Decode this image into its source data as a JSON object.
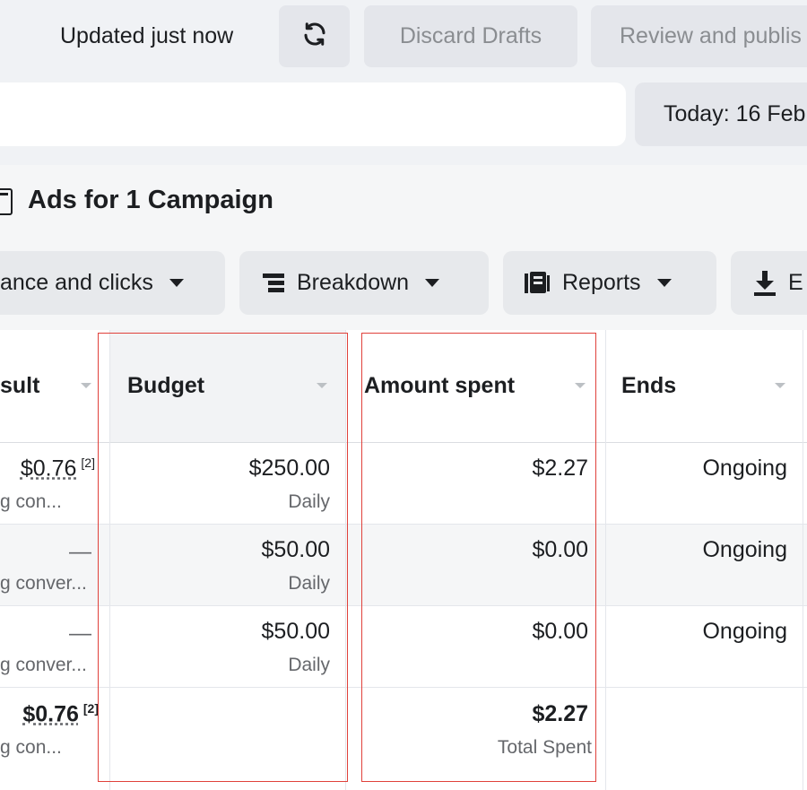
{
  "topbar": {
    "updated_text": "Updated just now",
    "discard_label": "Discard Drafts",
    "review_label": "Review and publis"
  },
  "date": {
    "label": "Today: 16 Feb"
  },
  "panel": {
    "title": "Ads for 1 Campaign"
  },
  "toolbar": {
    "performance_label": "ance and clicks",
    "breakdown_label": "Breakdown",
    "reports_label": "Reports",
    "export_label": "E"
  },
  "table": {
    "headers": {
      "result": "sult",
      "budget": "Budget",
      "amount_spent": "Amount spent",
      "ends": "Ends"
    },
    "rows": [
      {
        "result": "$0.76",
        "result_fn": "[2]",
        "result_sub": "g con...",
        "budget": "$250.00",
        "budget_sub": "Daily",
        "spent": "$2.27",
        "ends": "Ongoing"
      },
      {
        "result": "—",
        "result_sub": "g conver...",
        "budget": "$50.00",
        "budget_sub": "Daily",
        "spent": "$0.00",
        "ends": "Ongoing"
      },
      {
        "result": "—",
        "result_sub": "g conver...",
        "budget": "$50.00",
        "budget_sub": "Daily",
        "spent": "$0.00",
        "ends": "Ongoing"
      }
    ],
    "total": {
      "result": "$0.76",
      "result_fn": "[2]",
      "result_sub": "g con...",
      "spent": "$2.27",
      "spent_sub": "Total Spent"
    }
  },
  "colors": {
    "highlight": "#e0413b",
    "button_bg": "#e4e6eb",
    "disabled_text": "#8a8d91"
  },
  "icons": [
    "refresh-icon",
    "document-icon",
    "breakdown-icon",
    "reports-icon",
    "download-icon",
    "caret-down-icon",
    "sort-caret-icon"
  ]
}
